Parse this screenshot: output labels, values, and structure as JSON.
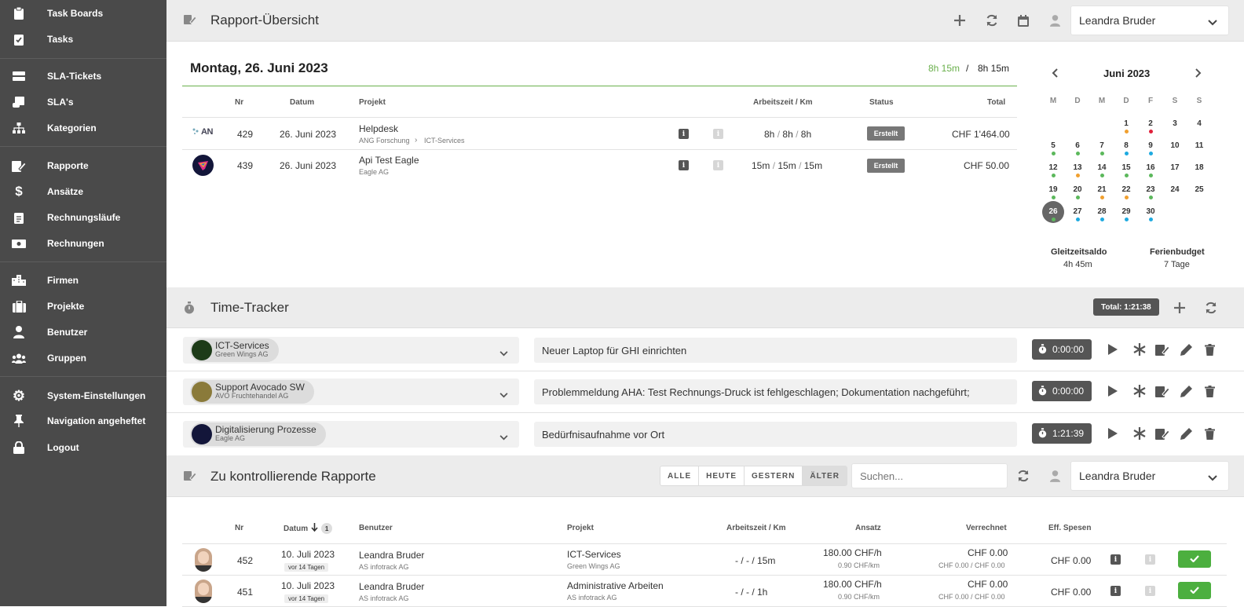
{
  "sidebar": {
    "items": [
      {
        "label": "Task Boards",
        "icon": "clipboard-icon"
      },
      {
        "label": "Tasks",
        "icon": "clipboard-check-icon"
      },
      {
        "label": "SLA-Tickets",
        "icon": "server-icon"
      },
      {
        "label": "SLA's",
        "icon": "scroll-icon"
      },
      {
        "label": "Kategorien",
        "icon": "sitemap-icon"
      },
      {
        "label": "Rapporte",
        "icon": "report-edit-icon"
      },
      {
        "label": "Ansätze",
        "icon": "dollar-icon"
      },
      {
        "label": "Rechnungsläufe",
        "icon": "clipboard-list-icon"
      },
      {
        "label": "Rechnungen",
        "icon": "money-bill-icon"
      },
      {
        "label": "Firmen",
        "icon": "city-icon"
      },
      {
        "label": "Projekte",
        "icon": "briefcase-icon"
      },
      {
        "label": "Benutzer",
        "icon": "user-icon"
      },
      {
        "label": "Gruppen",
        "icon": "users-icon"
      },
      {
        "label": "System-Einstellungen",
        "icon": "gear-icon"
      },
      {
        "label": "Navigation angeheftet",
        "icon": "pin-icon"
      },
      {
        "label": "Logout",
        "icon": "lock-icon"
      }
    ]
  },
  "header": {
    "title": "Rapport-Übersicht",
    "user": "Leandra Bruder"
  },
  "rapport": {
    "date_title": "Montag, 26. Juni 2023",
    "time_done": "8h 15m",
    "time_sep": "/",
    "time_target": "8h 15m",
    "columns": {
      "nr": "Nr",
      "datum": "Datum",
      "projekt": "Projekt",
      "arbeitszeit": "Arbeitszeit / Km",
      "status": "Status",
      "total": "Total"
    },
    "rows": [
      {
        "nr": "429",
        "datum": "26. Juni 2023",
        "projekt": "Helpdesk",
        "firma": "ANG Forschung",
        "sub_projekt": "ICT-Services",
        "zeit1": "8h",
        "zeit2": "8h",
        "zeit3": "8h",
        "status": "Erstellt",
        "total": "CHF 1'464.00"
      },
      {
        "nr": "439",
        "datum": "26. Juni 2023",
        "projekt": "Api Test Eagle",
        "firma": "Eagle AG",
        "sub_projekt": "",
        "zeit1": "15m",
        "zeit2": "15m",
        "zeit3": "15m",
        "status": "Erstellt",
        "total": "CHF 50.00"
      }
    ],
    "logo_text": "AN"
  },
  "calendar": {
    "month": "Juni 2023",
    "weekdays": [
      "M",
      "D",
      "M",
      "D",
      "F",
      "S",
      "S"
    ],
    "weeks": [
      [
        "",
        "",
        "",
        "1",
        "2",
        "3",
        "4"
      ],
      [
        "5",
        "6",
        "7",
        "8",
        "9",
        "10",
        "11"
      ],
      [
        "12",
        "13",
        "14",
        "15",
        "16",
        "17",
        "18"
      ],
      [
        "19",
        "20",
        "21",
        "22",
        "23",
        "24",
        "25"
      ],
      [
        "26",
        "27",
        "28",
        "29",
        "30",
        "",
        ""
      ]
    ],
    "selected_day": "26",
    "gleitzeit_label": "Gleitzeitsaldo",
    "gleitzeit_value": "4h 45m",
    "ferien_label": "Ferienbudget",
    "ferien_value": "7 Tage",
    "colors": {
      "green": "#5cb85c",
      "orange": "#f0a030",
      "red": "#e0203a",
      "blue": "#1eaae0"
    }
  },
  "timetracker": {
    "title": "Time-Tracker",
    "total": "Total: 1:21:38",
    "entries": [
      {
        "project": "ICT-Services",
        "company": "Green Wings AG",
        "description": "Neuer Laptop für GHI einrichten",
        "time": "0:00:00"
      },
      {
        "project": "Support Avocado SW",
        "company": "AVO Fruchtehandel AG",
        "description": "Problemmeldung AHA: Test Rechnungs-Druck ist fehlgeschlagen; Dokumentation nachgeführt;",
        "time": "0:00:00"
      },
      {
        "project": "Digitalisierung Prozesse",
        "company": "Eagle AG",
        "description": "Bedürfnisaufnahme vor Ort",
        "time": "1:21:39"
      }
    ]
  },
  "kontrolle": {
    "title": "Zu kontrollierende Rapporte",
    "filters": [
      "ALLE",
      "HEUTE",
      "GESTERN",
      "ÄLTER"
    ],
    "search_placeholder": "Suchen...",
    "user": "Leandra Bruder",
    "columns": {
      "nr": "Nr",
      "datum": "Datum",
      "sort_count": "1",
      "benutzer": "Benutzer",
      "projekt": "Projekt",
      "arbeitszeit": "Arbeitszeit / Km",
      "ansatz": "Ansatz",
      "verrechnet": "Verrechnet",
      "spesen": "Eff. Spesen"
    },
    "rows": [
      {
        "nr": "452",
        "datum": "10. Juli 2023",
        "ago": "vor 14 Tagen",
        "benutzer": "Leandra Bruder",
        "firma": "AS infotrack AG",
        "projekt": "ICT-Services",
        "projekt_firma": "Green Wings AG",
        "zeit": "- / - / 15m",
        "ansatz": "180.00 CHF/h",
        "ansatz_km": "0.90 CHF/km",
        "verrechnet": "CHF 0.00",
        "verrechnet_sub": "CHF 0.00 / CHF 0.00",
        "spesen": "CHF 0.00"
      },
      {
        "nr": "451",
        "datum": "10. Juli 2023",
        "ago": "vor 14 Tagen",
        "benutzer": "Leandra Bruder",
        "firma": "AS infotrack AG",
        "projekt": "Administrative Arbeiten",
        "projekt_firma": "AS infotrack AG",
        "zeit": "- / - / 1h",
        "ansatz": "180.00 CHF/h",
        "ansatz_km": "0.90 CHF/km",
        "verrechnet": "CHF 0.00",
        "verrechnet_sub": "CHF 0.00 / CHF 0.00",
        "spesen": "CHF 0.00"
      }
    ]
  }
}
